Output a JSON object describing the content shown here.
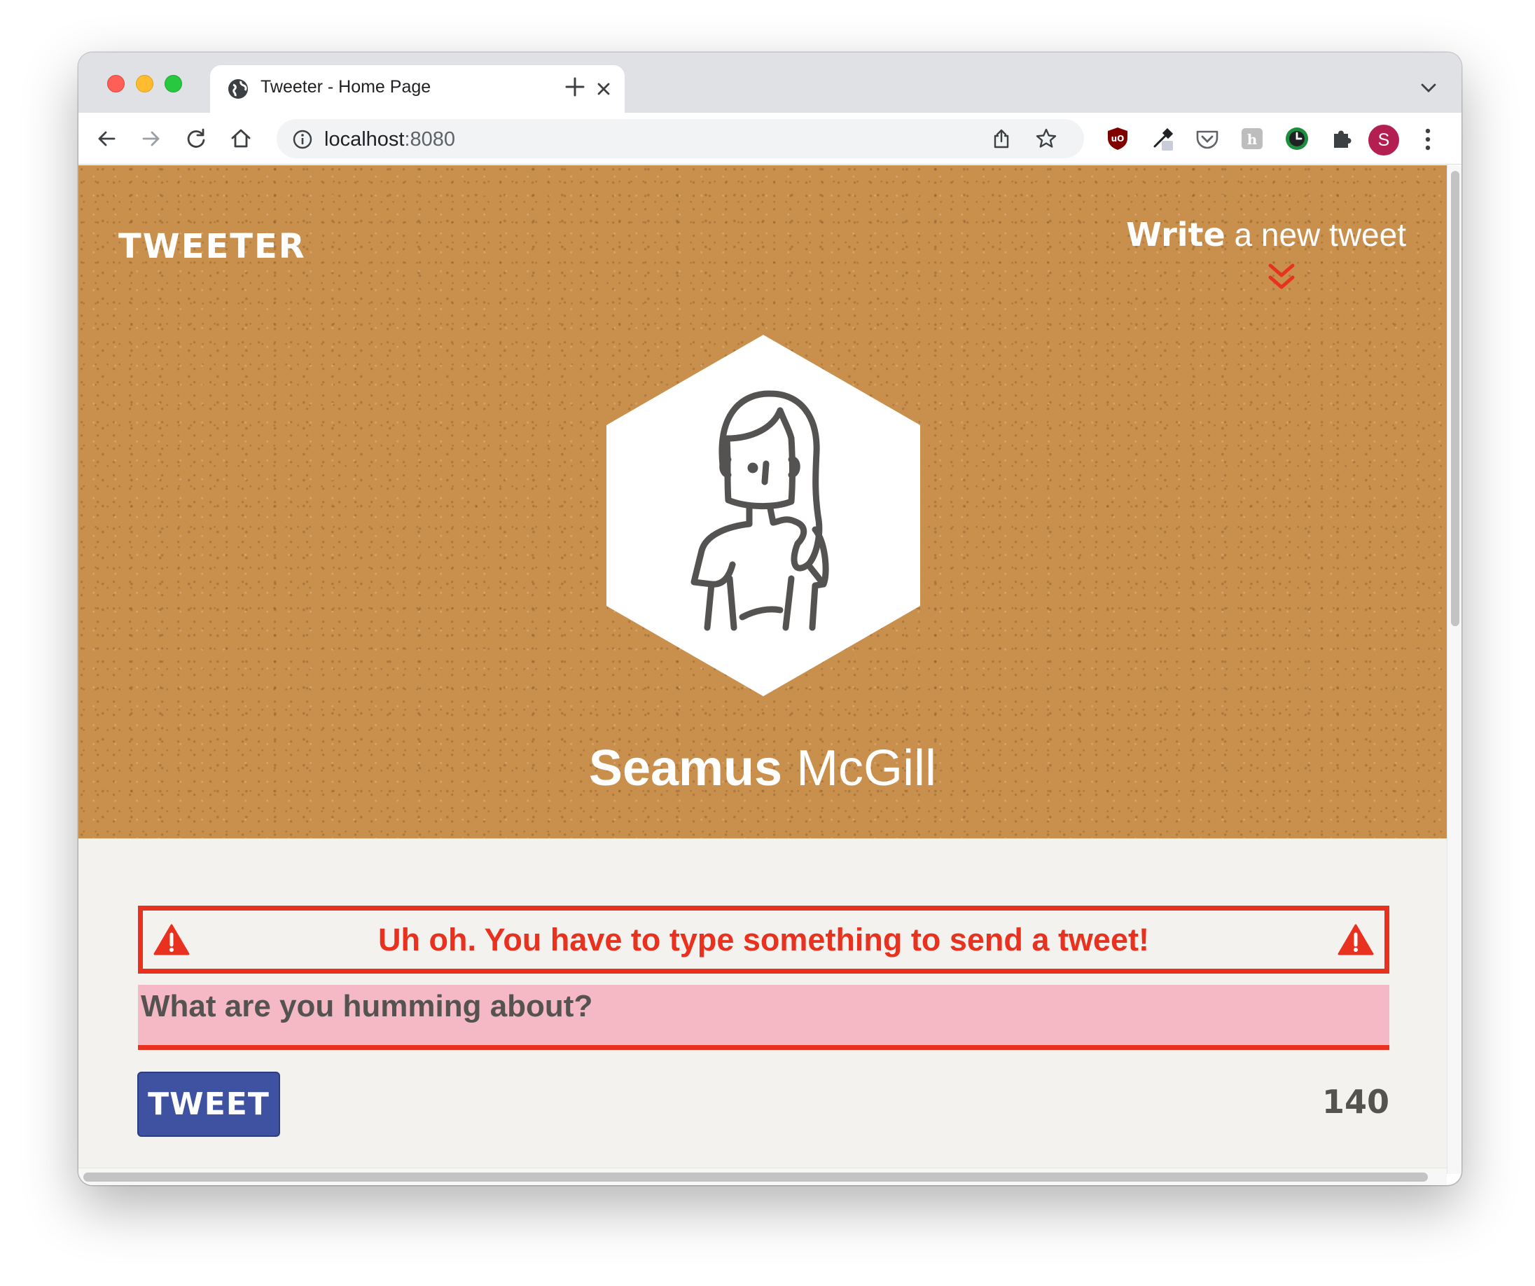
{
  "browser": {
    "tab_title": "Tweeter - Home Page",
    "url_host": "localhost",
    "url_port": ":8080",
    "profile_initial": "S",
    "icons": {
      "back": "arrow-left-icon",
      "forward": "arrow-right-icon",
      "reload": "reload-icon",
      "home": "home-icon",
      "info": "info-icon",
      "share": "share-icon",
      "bookmark": "star-icon",
      "extensions": [
        "ublock-icon",
        "eyedropper-icon",
        "pocket-icon",
        "hugo-icon",
        "clock-icon",
        "puzzle-icon"
      ],
      "menu": "kebab-menu-icon"
    }
  },
  "page": {
    "logo": "TWEETER",
    "write_bold": "Write",
    "write_rest": " a new tweet",
    "user_first": "Seamus",
    "user_last": " McGill",
    "error_message": "Uh oh. You have to type something to send a tweet!",
    "composer_placeholder": "What are you humming about?",
    "tweet_button": "TWEET",
    "char_counter": "140",
    "colors": {
      "hero_bg": "#c98f4d",
      "error_red": "#e8321f",
      "composer_bg": "#f4b9c4",
      "button_blue": "#3f52a1",
      "page_bg": "#f4f2ef"
    }
  }
}
